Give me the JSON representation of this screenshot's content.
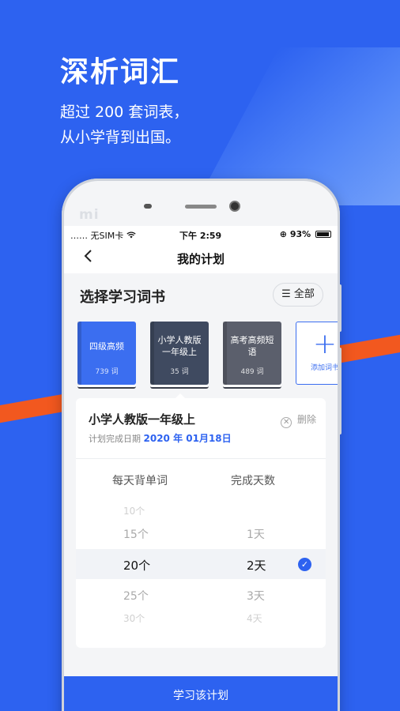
{
  "promo": {
    "title": "深析词汇",
    "subtitle_line1": "超过 200 套词表，",
    "subtitle_line2": "从小学背到出国。"
  },
  "device": {
    "brand_logo": "mi"
  },
  "status_bar": {
    "carrier": "…… 无SIM卡",
    "time": "下午 2:59",
    "battery": "93%"
  },
  "nav": {
    "back_icon": "chevron-left-icon",
    "title": "我的计划"
  },
  "section": {
    "title": "选择学习词书",
    "all_button": "全部"
  },
  "books": [
    {
      "name": "四级高频",
      "count": "739 词",
      "color": "#3b6ef0"
    },
    {
      "name": "小学人教版一年级上",
      "count": "35 词",
      "color": "#3f4a60"
    },
    {
      "name": "高考高频短语",
      "count": "489 词",
      "color": "#5b5f6c"
    }
  ],
  "add_book": {
    "label": "添加词书"
  },
  "plan": {
    "name": "小学人教版一年级上",
    "date_label": "计划完成日期",
    "date_value": "2020 年 01月18日",
    "delete_label": "删除",
    "col_words": "每天背单词",
    "col_days": "完成天数",
    "rows": [
      {
        "words": "10个",
        "days": ""
      },
      {
        "words": "15个",
        "days": "1天"
      },
      {
        "words": "20个",
        "days": "2天"
      },
      {
        "words": "25个",
        "days": "3天"
      },
      {
        "words": "30个",
        "days": "4天"
      }
    ],
    "selected_index": 2
  },
  "study_button": "学习该计划",
  "colors": {
    "primary": "#2d62f0",
    "accent_orange": "#f2581f"
  }
}
